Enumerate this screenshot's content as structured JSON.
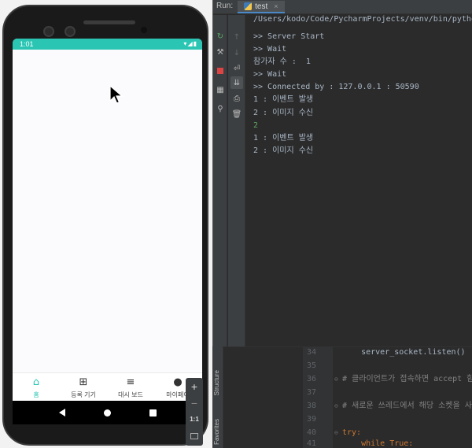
{
  "emulator": {
    "status_time": "1:01",
    "status_icons": "▾◢▮",
    "bottom_nav": [
      {
        "label": "홈",
        "icon": "home-icon",
        "glyph": "⌂",
        "active": true
      },
      {
        "label": "등록 기기",
        "icon": "add-device-icon",
        "glyph": "⊞",
        "active": false
      },
      {
        "label": "대시 보드",
        "icon": "dashboard-search-icon",
        "glyph": "≡",
        "active": false
      },
      {
        "label": "마이페이",
        "icon": "account-icon",
        "glyph": "●",
        "active": false
      }
    ],
    "accent_color": "#2ac5b3",
    "zoom_controls": {
      "plus": "+",
      "minus": "−",
      "one_to_one": "1:1"
    }
  },
  "run_panel": {
    "title": "Run:",
    "tab_label": "test",
    "tab_close": "×",
    "command_path": "/Users/kodo/Code/PycharmProjects/venv/bin/python",
    "console_lines": [
      {
        "text": ">> Server Start",
        "type": "output"
      },
      {
        "text": ">> Wait",
        "type": "output"
      },
      {
        "text": "참가자 수 :  1",
        "type": "output"
      },
      {
        "text": ">> Wait",
        "type": "output"
      },
      {
        "text": ">> Connected by : 127.0.0.1 : 50590",
        "type": "output"
      },
      {
        "text": "1 : 이벤트 발생",
        "type": "output"
      },
      {
        "text": "2 : 이미지 수신",
        "type": "output"
      },
      {
        "text": "2",
        "type": "input"
      },
      {
        "text": "1 : 이벤트 발생",
        "type": "output"
      },
      {
        "text": "2 : 이미지 수신",
        "type": "output"
      }
    ]
  },
  "side_tabs": {
    "structure": "Structure",
    "favorites": "Favorites"
  },
  "editor": {
    "lines": [
      {
        "num": "34",
        "text": "    server_socket.listen()",
        "kind": "code"
      },
      {
        "num": "35",
        "text": "",
        "kind": "code"
      },
      {
        "num": "36",
        "text": "# 클라이언트가 접속하면 accept 함수에서",
        "kind": "comment"
      },
      {
        "num": "37",
        "text": "",
        "kind": "code"
      },
      {
        "num": "38",
        "text": "# 새로운 쓰레드에서 해당 소켓을 사용하여",
        "kind": "comment"
      },
      {
        "num": "39",
        "text": "",
        "kind": "code"
      },
      {
        "num": "40",
        "text": "try:",
        "kind": "keyword"
      },
      {
        "num": "41",
        "text": "    while True:",
        "kind": "keyword"
      }
    ]
  }
}
